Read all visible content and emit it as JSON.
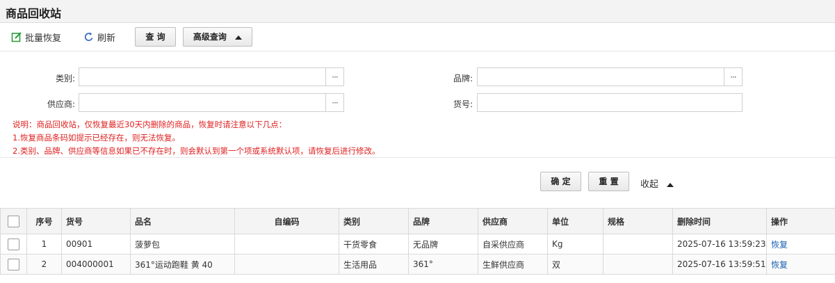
{
  "page": {
    "title": "商品回收站"
  },
  "toolbar": {
    "batch_restore": "批量恢复",
    "refresh": "刷新",
    "query": "查 询",
    "advanced_query": "高级查询"
  },
  "filters": {
    "category_label": "类别:",
    "brand_label": "品牌:",
    "supplier_label": "供应商:",
    "sku_label": "货号:",
    "category_value": "",
    "brand_value": "",
    "supplier_value": "",
    "sku_value": "",
    "picker": "···"
  },
  "notes": {
    "line1": "说明：商品回收站，仅恢复最近30天内删除的商品，恢复时请注意以下几点：",
    "line2": "1.恢复商品条码如提示已经存在，则无法恢复。",
    "line3": "2.类别、品牌、供应商等信息如果已不存在时，则会默认到第一个项或系统默认项，请恢复后进行修改。"
  },
  "actions": {
    "confirm": "确 定",
    "reset": "重 置",
    "collapse": "收起"
  },
  "table": {
    "headers": {
      "seq": "序号",
      "sku": "货号",
      "name": "品名",
      "code": "自编码",
      "category": "类别",
      "brand": "品牌",
      "supplier": "供应商",
      "unit": "单位",
      "spec": "规格",
      "deleted_at": "删除时间",
      "op": "操作"
    },
    "rows": [
      {
        "seq": "1",
        "sku": "00901",
        "name": "菠萝包",
        "code": "",
        "category": "干货零食",
        "brand": "无品牌",
        "supplier": "自采供应商",
        "unit": "Kg",
        "spec": "",
        "deleted_at": "2025-07-16 13:59:23",
        "op": "恢复"
      },
      {
        "seq": "2",
        "sku": "004000001",
        "name": "361°运动跑鞋 黄 40",
        "code": "",
        "category": "生活用品",
        "brand": "361°",
        "supplier": "生鲜供应商",
        "unit": "双",
        "spec": "",
        "deleted_at": "2025-07-16 13:59:51",
        "op": "恢复"
      }
    ]
  },
  "colors": {
    "note_red": "#e02020",
    "link_blue": "#1a5fb4",
    "icon_green": "#2e9b3e",
    "icon_blue": "#3a6fc4"
  }
}
